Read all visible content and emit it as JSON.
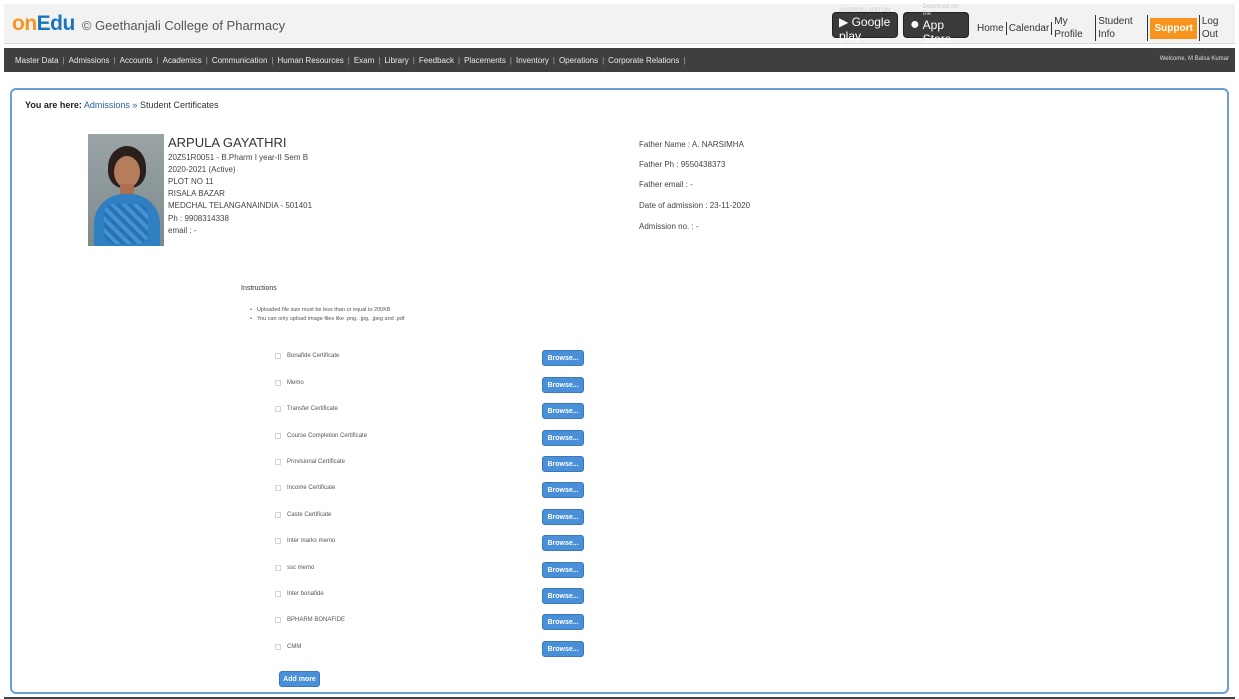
{
  "header": {
    "brand_on": "on",
    "brand_edu": "Edu",
    "college": "© Geethanjali College of Pharmacy",
    "google_badge_small": "ANDROID APP ON",
    "google_badge_big": "Google play",
    "apple_badge_small": "Download on the",
    "apple_badge_big": "App Store",
    "links": [
      "Home",
      "Calendar",
      "My Profile",
      "Student Info"
    ],
    "support": "Support",
    "logout": "Log Out",
    "accent": "#f7941d",
    "brand_blue": "#1b75bb"
  },
  "nav": {
    "items": [
      "Master Data",
      "Admissions",
      "Accounts",
      "Academics",
      "Communication",
      "Human Resources",
      "Exam",
      "Library",
      "Feedback",
      "Placements",
      "Inventory",
      "Operations",
      "Corporate Relations"
    ],
    "welcome": "Welcome, M Balsa Kumar"
  },
  "breadcrumb": {
    "label": "You are here:",
    "admissions": "Admissions",
    "separator": "»",
    "current": "Student Certificates"
  },
  "student": {
    "name": "ARPULA GAYATHRI",
    "roll": "20Z51R0051 - B.Pharm I year-II Sem B",
    "year": "2020-2021 (Active)",
    "address1": "PLOT NO 11",
    "address2": "RISALA BAZAR",
    "address3": "MEDCHAL TELANGANAINDIA - 501401",
    "phone": "Ph : 9908314338",
    "email": "email : -"
  },
  "father": {
    "name": "Father Name : A. NARSIMHA",
    "phone": "Father Ph : 9550438373",
    "email": "Father email : -",
    "admission_date": "Date of admission : 23-11-2020",
    "admission_no": "Admission no. : -"
  },
  "instructions": {
    "title": "Instructions",
    "items": [
      "Uploaded file size must be less than or equal to 200KB",
      "You can only upload image files like .png, .jpg, .jpeg and .pdf"
    ]
  },
  "certificates": [
    "Bonafide Certificate",
    "Memo",
    "Transfer Certificate",
    "Course Completion Certificate",
    "Provisional Certificate",
    "Income Certificate",
    "Caste Certificate",
    "Inter marks memo",
    "ssc memo",
    "Inter bonafide",
    "BPHARM BONAFIDE",
    "CMM"
  ],
  "browse_label": "Browse...",
  "add_more_label": "Add more"
}
